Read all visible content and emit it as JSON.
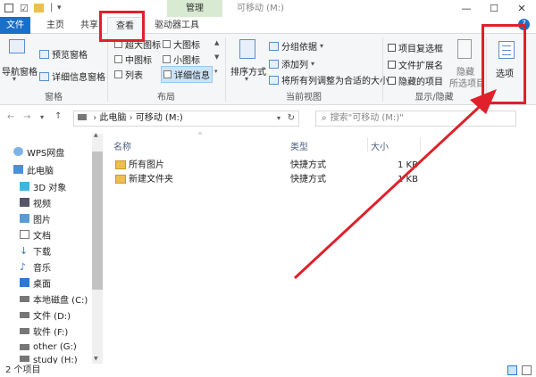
{
  "window": {
    "title": "可移动 (M:)",
    "context_tab": "管理",
    "minimize": "—",
    "maximize": "☐",
    "close": "✕"
  },
  "tabs": [
    "文件",
    "主页",
    "共享",
    "查看",
    "驱动器工具"
  ],
  "ribbon": {
    "panes": {
      "label": "窗格",
      "nav_pane": "导航窗格",
      "preview_pane": "预览窗格",
      "details_pane": "详细信息窗格"
    },
    "layout": {
      "label": "布局",
      "items": [
        "超大图标",
        "大图标",
        "中图标",
        "小图标",
        "列表",
        "详细信息"
      ]
    },
    "current_view": {
      "label": "当前视图",
      "sort": "排序方式",
      "group_by": "分组依据",
      "add_column": "添加列",
      "fit_columns": "将所有列调整为合适的大小"
    },
    "show_hide": {
      "label": "显示/隐藏",
      "item_checkboxes": "项目复选框",
      "file_extensions": "文件扩展名",
      "hidden_items": "隐藏的项目",
      "hide": "隐藏",
      "hide_selected": "所选项目"
    },
    "options": "选项"
  },
  "address": {
    "crumb1": "此电脑",
    "crumb2": "可移动 (M:)",
    "search_placeholder": "搜索\"可移动 (M:)\""
  },
  "nav": [
    {
      "label": "WPS网盘",
      "icon": "cloud-icon"
    },
    {
      "label": "此电脑",
      "icon": "computer-icon"
    },
    {
      "label": "3D 对象",
      "icon": "cube-icon"
    },
    {
      "label": "视频",
      "icon": "video-icon"
    },
    {
      "label": "图片",
      "icon": "picture-icon"
    },
    {
      "label": "文档",
      "icon": "document-icon"
    },
    {
      "label": "下载",
      "icon": "download-icon"
    },
    {
      "label": "音乐",
      "icon": "music-icon"
    },
    {
      "label": "桌面",
      "icon": "desktop-icon"
    },
    {
      "label": "本地磁盘 (C:)",
      "icon": "drive-icon"
    },
    {
      "label": "文件 (D:)",
      "icon": "drive-icon"
    },
    {
      "label": "软件 (F:)",
      "icon": "drive-icon"
    },
    {
      "label": "other (G:)",
      "icon": "drive-icon"
    },
    {
      "label": "study (H:)",
      "icon": "drive-icon"
    }
  ],
  "columns": {
    "name": "名称",
    "type": "类型",
    "size": "大小"
  },
  "files": [
    {
      "name": "所有图片",
      "type": "快捷方式",
      "size": "1 KB"
    },
    {
      "name": "新建文件夹",
      "type": "快捷方式",
      "size": "1 KB"
    }
  ],
  "status": "2 个项目",
  "colors": {
    "accent": "#1a6fc8",
    "highlight": "#e0202a"
  }
}
